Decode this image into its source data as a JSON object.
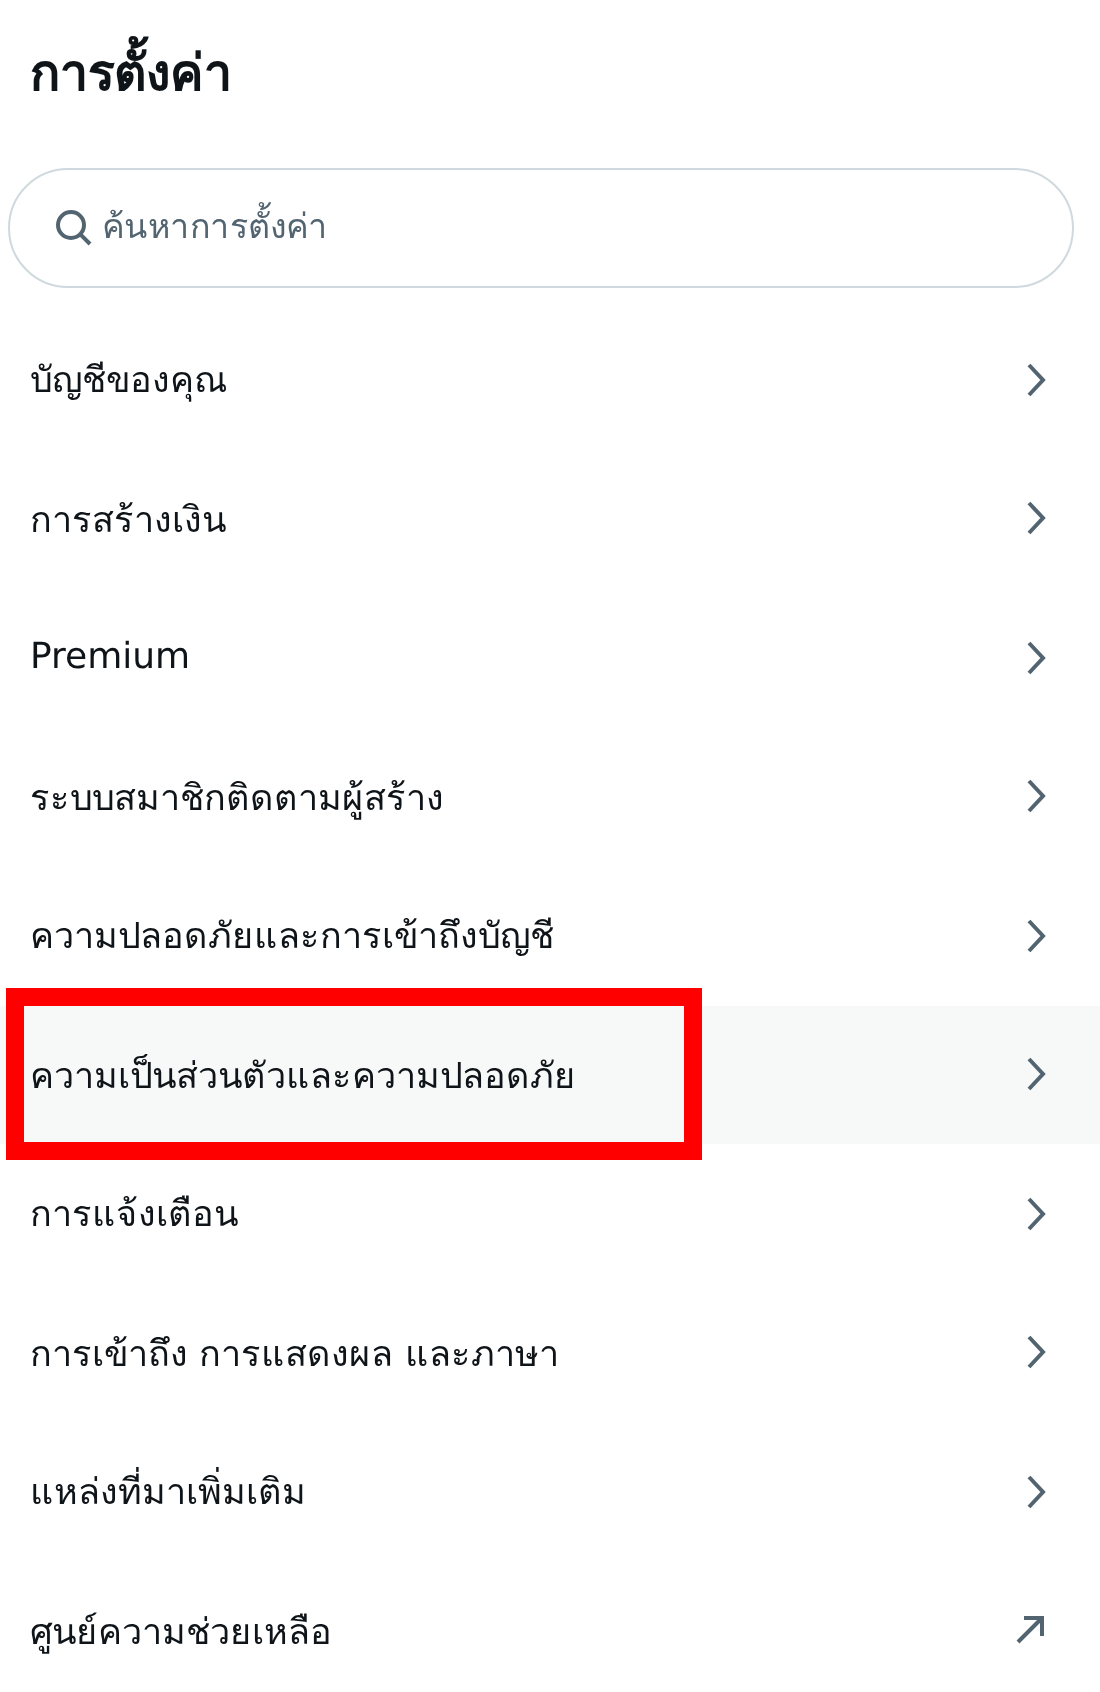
{
  "title": "การตั้งค่า",
  "search": {
    "placeholder": "ค้นหาการตั้งค่า"
  },
  "items": [
    {
      "label": "บัญชีของคุณ",
      "kind": "chevron",
      "selected": false,
      "outlined": false
    },
    {
      "label": "การสร้างเงิน",
      "kind": "chevron",
      "selected": false,
      "outlined": false
    },
    {
      "label": "Premium",
      "kind": "chevron",
      "selected": false,
      "outlined": false
    },
    {
      "label": "ระบบสมาชิกติดตามผู้สร้าง",
      "kind": "chevron",
      "selected": false,
      "outlined": false
    },
    {
      "label": "ความปลอดภัยและการเข้าถึงบัญชี",
      "kind": "chevron",
      "selected": false,
      "outlined": false
    },
    {
      "label": "ความเป็นส่วนตัวและความปลอดภัย",
      "kind": "chevron",
      "selected": true,
      "outlined": true
    },
    {
      "label": "การแจ้งเตือน",
      "kind": "chevron",
      "selected": false,
      "outlined": false
    },
    {
      "label": "การเข้าถึง การแสดงผล และภาษา",
      "kind": "chevron",
      "selected": false,
      "outlined": false
    },
    {
      "label": "แหล่งที่มาเพิ่มเติม",
      "kind": "chevron",
      "selected": false,
      "outlined": false
    },
    {
      "label": "ศูนย์ความช่วยเหลือ",
      "kind": "external",
      "selected": false,
      "outlined": false
    }
  ]
}
